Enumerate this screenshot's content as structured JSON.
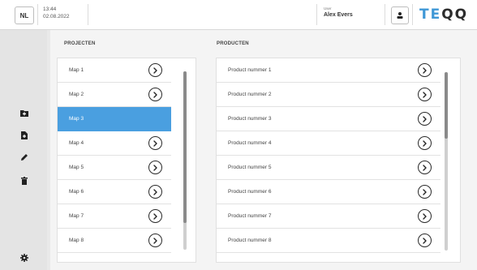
{
  "header": {
    "language": "NL",
    "time": "13:44",
    "date": "02.08.2022",
    "user_label": "User",
    "user_name": "Alex Evers",
    "logo_left": "TE",
    "logo_right": "QQ",
    "brand_color": "#3e97d6"
  },
  "sidebar": {
    "icons": [
      "add-folder-icon",
      "add-file-icon",
      "pencil-icon",
      "trash-icon",
      "gear-icon"
    ]
  },
  "projects": {
    "title": "PROJECTEN",
    "items": [
      "Map 1",
      "Map 2",
      "Map 3",
      "Map 4",
      "Map 5",
      "Map 6",
      "Map 7",
      "Map 8"
    ],
    "selected": "Map 3",
    "selected_color": "#4a9fe0"
  },
  "products": {
    "title": "PRODUCTEN",
    "items": [
      "Product nummer 1",
      "Product nummer 2",
      "Product nummer 3",
      "Product nummer 4",
      "Product nummer 5",
      "Product nummer 6",
      "Product nummer 7",
      "Product nummer 8"
    ]
  }
}
